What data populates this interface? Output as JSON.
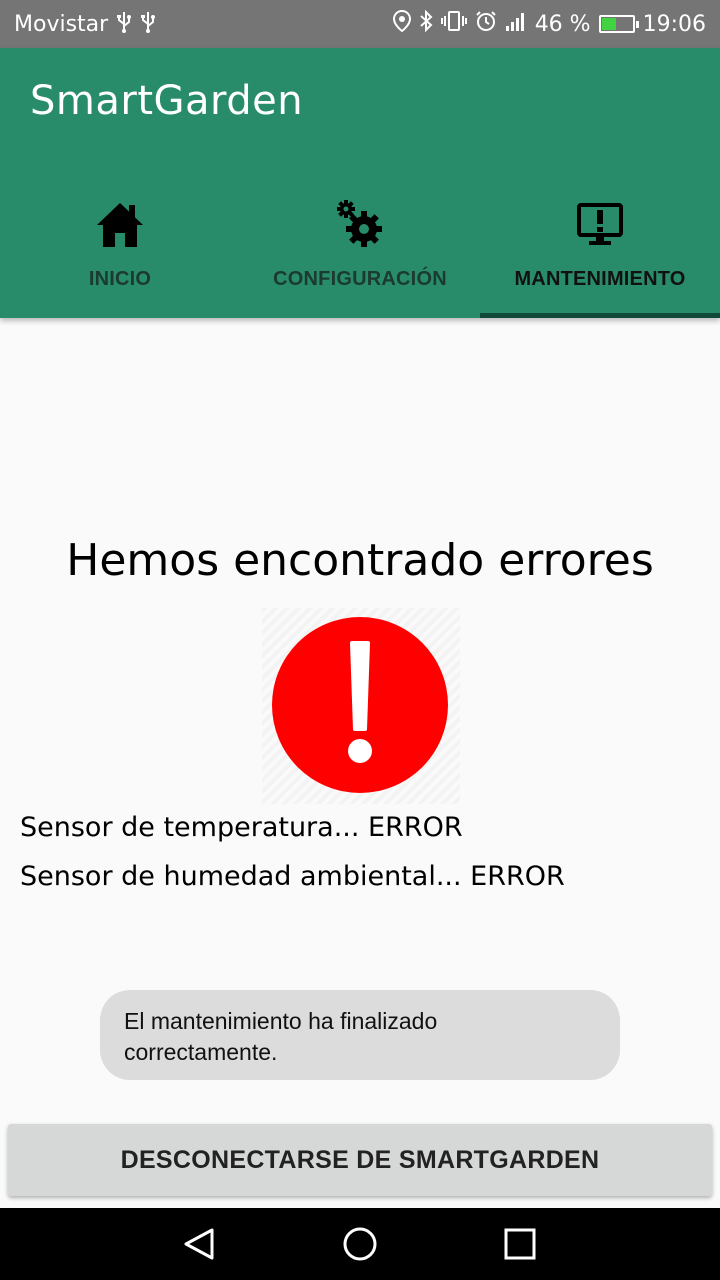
{
  "status_bar": {
    "carrier": "Movistar",
    "usb_icons": [
      "usb-icon",
      "usb-icon"
    ],
    "right_icons": [
      "location-icon",
      "bluetooth-icon",
      "vibrate-icon",
      "alarm-icon",
      "signal-icon"
    ],
    "battery_percent": "46 %",
    "battery_level": 0.46,
    "time": "19:06"
  },
  "app_bar": {
    "title": "SmartGarden",
    "color": "#288c6a",
    "tabs": [
      {
        "label": "INICIO",
        "icon": "home-icon",
        "active": false
      },
      {
        "label": "CONFIGURACIÓN",
        "icon": "gears-icon",
        "active": false
      },
      {
        "label": "MANTENIMIENTO",
        "icon": "monitor-alert-icon",
        "active": true
      }
    ]
  },
  "content": {
    "headline": "Hemos encontrado errores",
    "error_icon": "exclamation-circle-icon",
    "error_color": "#ff0000",
    "sensors": [
      "Sensor de temperatura... ERROR",
      "Sensor de humedad ambiental... ERROR"
    ]
  },
  "toast": {
    "message": "El mantenimiento ha finalizado correctamente."
  },
  "actions": {
    "disconnect_label": "DESCONECTARSE DE SMARTGARDEN"
  },
  "nav_bar": {
    "buttons": [
      "back-icon",
      "home-circle-icon",
      "recents-icon"
    ]
  }
}
